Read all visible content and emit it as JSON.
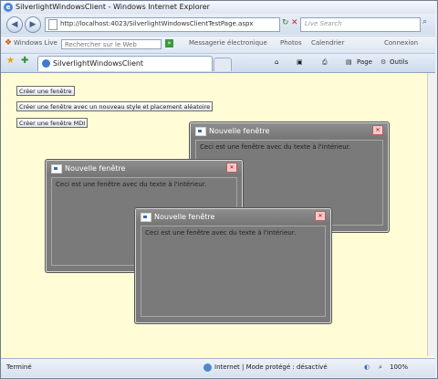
{
  "window": {
    "title": "SilverlightWindowsClient - Windows Internet Explorer"
  },
  "address": {
    "url": "http://localhost:4023/SilverlightWindowsClientTestPage.aspx",
    "search_placeholder": "Live Search"
  },
  "links": {
    "windows_live": "Windows Live",
    "search_web_placeholder": "Rechercher sur le Web",
    "messagerie": "Messagerie électronique",
    "photos": "Photos",
    "calendrier": "Calendrier",
    "connexion": "Connexion"
  },
  "tab": {
    "title": "SilverlightWindowsClient"
  },
  "commands": {
    "page": "Page",
    "outils": "Outils"
  },
  "buttons": [
    {
      "label": "Créer une fenêtre"
    },
    {
      "label": "Créer une fenêtre avec un nouveau style et placement aléatoire"
    },
    {
      "label": "Créer une fenêtre MDI"
    }
  ],
  "windows": [
    {
      "title": "Nouvelle fenêtre",
      "text": "Ceci est une fenêtre avec du texte à l'intérieur."
    },
    {
      "title": "Nouvelle fenêtre",
      "text": "Ceci est une fenêtre avec du texte à l'intérieur."
    },
    {
      "title": "Nouvelle fenêtre",
      "text": "Ceci est une fenêtre avec du texte à l'intérieur."
    }
  ],
  "status": {
    "left": "Terminé",
    "zone": "Internet | Mode protégé : désactivé",
    "zoom": "100%"
  }
}
